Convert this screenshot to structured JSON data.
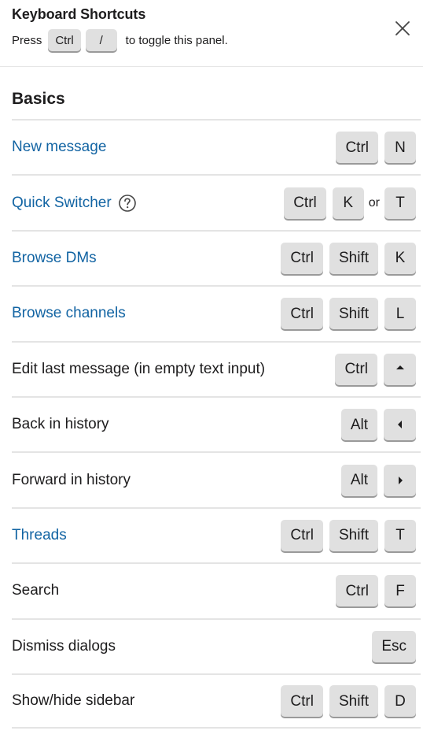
{
  "header": {
    "title": "Keyboard Shortcuts",
    "press_label": "Press",
    "toggle_keys": [
      "Ctrl",
      "/"
    ],
    "toggle_suffix": "to toggle this panel.",
    "close_icon": "close-icon"
  },
  "section": {
    "title": "Basics"
  },
  "shortcuts": [
    {
      "label": "New message",
      "link": true,
      "keys": [
        "Ctrl",
        "N"
      ]
    },
    {
      "label": "Quick Switcher",
      "link": true,
      "help_icon": "question-circle-icon",
      "keys": [
        "Ctrl",
        "K"
      ],
      "or_label": "or",
      "alt_keys": [
        "T"
      ]
    },
    {
      "label": "Browse DMs",
      "link": true,
      "keys": [
        "Ctrl",
        "Shift",
        "K"
      ]
    },
    {
      "label": "Browse channels",
      "link": true,
      "keys": [
        "Ctrl",
        "Shift",
        "L"
      ]
    },
    {
      "label": "Edit last message (in empty text input)",
      "link": false,
      "keys": [
        "Ctrl",
        "arrow-up-icon"
      ]
    },
    {
      "label": "Back in history",
      "link": false,
      "keys": [
        "Alt",
        "arrow-left-icon"
      ]
    },
    {
      "label": "Forward in history",
      "link": false,
      "keys": [
        "Alt",
        "arrow-right-icon"
      ]
    },
    {
      "label": "Threads",
      "link": true,
      "keys": [
        "Ctrl",
        "Shift",
        "T"
      ]
    },
    {
      "label": "Search",
      "link": false,
      "keys": [
        "Ctrl",
        "F"
      ]
    },
    {
      "label": "Dismiss dialogs",
      "link": false,
      "keys": [
        "Esc"
      ]
    },
    {
      "label": "Show/hide sidebar",
      "link": false,
      "keys": [
        "Ctrl",
        "Shift",
        "D"
      ]
    }
  ],
  "colors": {
    "link": "#1264a3",
    "text": "#1d1c1d",
    "key_bg": "#e0e0e0",
    "divider": "#e4e4e4"
  }
}
